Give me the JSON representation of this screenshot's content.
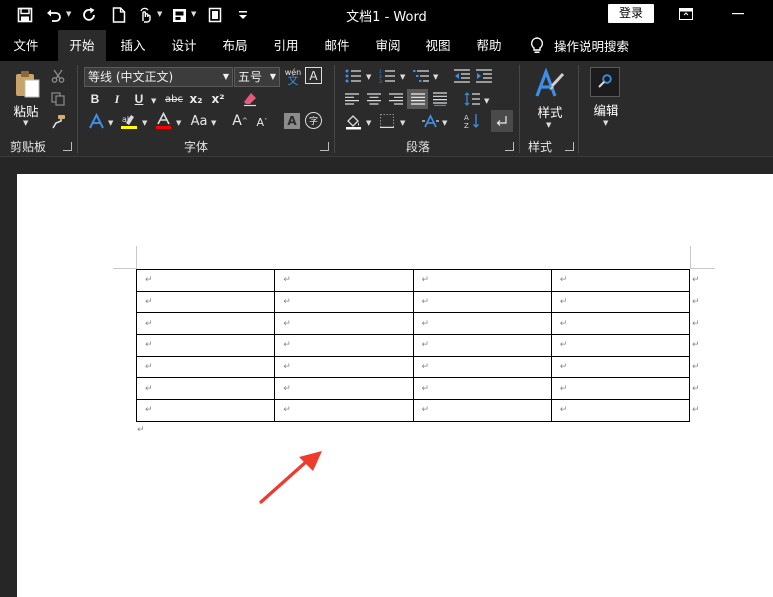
{
  "window": {
    "title": "文档1  -  Word",
    "login_label": "登录"
  },
  "quick_access": [
    "save-icon",
    "undo-icon",
    "redo-icon",
    "new-document-icon",
    "touch-mode-icon",
    "format-icon",
    "print-preview-icon",
    "customize-icon"
  ],
  "tabs": [
    {
      "label": "文件",
      "active": false
    },
    {
      "label": "开始",
      "active": true
    },
    {
      "label": "插入",
      "active": false
    },
    {
      "label": "设计",
      "active": false
    },
    {
      "label": "布局",
      "active": false
    },
    {
      "label": "引用",
      "active": false
    },
    {
      "label": "邮件",
      "active": false
    },
    {
      "label": "审阅",
      "active": false
    },
    {
      "label": "视图",
      "active": false
    },
    {
      "label": "帮助",
      "active": false
    }
  ],
  "tell_me": {
    "label": "操作说明搜索"
  },
  "ribbon": {
    "clipboard": {
      "paste_label": "粘贴",
      "group_label": "剪贴板"
    },
    "font": {
      "font_name": "等线 (中文正文)",
      "font_size": "五号",
      "group_label": "字体",
      "bold": "B",
      "italic": "I",
      "underline": "U",
      "strike": "abc",
      "subscript": "x₂",
      "superscript": "x²",
      "change_case": "Aa",
      "grow": "A",
      "shrink": "A",
      "char_shade": "A",
      "enclose": "字",
      "phonetic": "wén",
      "char_border": "A"
    },
    "paragraph": {
      "group_label": "段落"
    },
    "styles": {
      "button_label": "样式",
      "group_label": "样式"
    },
    "editing": {
      "button_label": "编辑"
    }
  },
  "colors": {
    "accent_blue": "#3c8ee6",
    "highlight_yellow": "#ffff00",
    "font_red": "#ff0000",
    "arrow_red": "#ef3b2d"
  },
  "document": {
    "table": {
      "rows": 7,
      "columns": 4,
      "cells": [
        [
          "↵",
          "↵",
          "↵",
          "↵"
        ],
        [
          "↵",
          "↵",
          "↵",
          "↵"
        ],
        [
          "↵",
          "↵",
          "↵",
          "↵"
        ],
        [
          "↵",
          "↵",
          "↵",
          "↵"
        ],
        [
          "↵",
          "↵",
          "↵",
          "↵"
        ],
        [
          "↵",
          "↵",
          "↵",
          "↵"
        ],
        [
          "↵",
          "↵",
          "↵",
          "↵"
        ]
      ],
      "row_marks": [
        "↵",
        "↵",
        "↵",
        "↵",
        "↵",
        "↵",
        "↵"
      ]
    },
    "paragraph_mark": "↵"
  }
}
